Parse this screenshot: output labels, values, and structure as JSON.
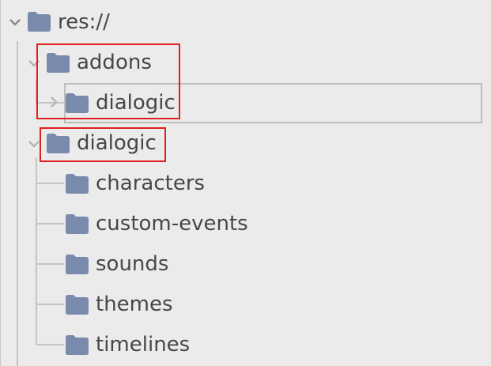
{
  "tree": {
    "root": {
      "label": "res://",
      "icon": "folder-icon",
      "expanded": true
    },
    "addons": {
      "label": "addons",
      "icon": "folder-icon",
      "expanded": true
    },
    "addons_dialogic": {
      "label": "dialogic",
      "icon": "folder-icon",
      "expanded": false
    },
    "dialogic": {
      "label": "dialogic",
      "icon": "folder-icon",
      "expanded": true
    },
    "children": [
      {
        "label": "characters",
        "icon": "folder-icon"
      },
      {
        "label": "custom-events",
        "icon": "folder-icon"
      },
      {
        "label": "sounds",
        "icon": "folder-icon"
      },
      {
        "label": "themes",
        "icon": "folder-icon"
      },
      {
        "label": "timelines",
        "icon": "folder-icon"
      }
    ]
  },
  "colors": {
    "folder": "#7a8aad",
    "text": "#474747",
    "highlight": "#e02020",
    "background": "#ebebeb"
  }
}
